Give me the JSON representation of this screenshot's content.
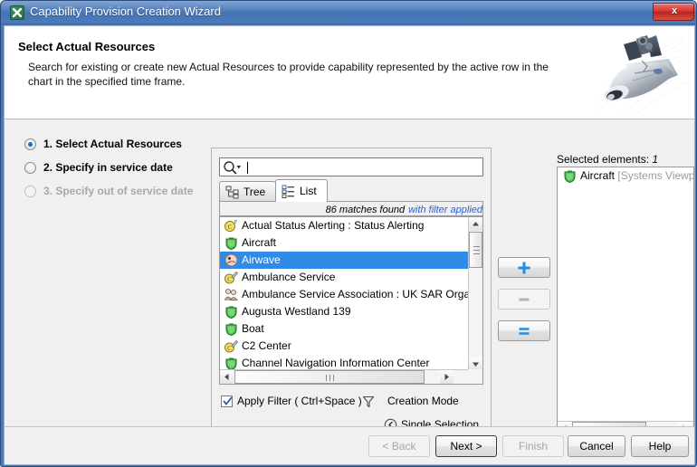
{
  "window": {
    "title": "Capability Provision Creation Wizard",
    "icon": "app-icon",
    "close_label": "x"
  },
  "banner": {
    "title": "Select Actual Resources",
    "description": "Search for existing or create new Actual Resources to provide capability represented by the active row in the chart in the specified time frame.",
    "graphic": "space-shuttle-image"
  },
  "steps": [
    {
      "label": "1. Select Actual Resources",
      "state": "selected"
    },
    {
      "label": "2. Specify in service date",
      "state": "enabled"
    },
    {
      "label": "3. Specify out of service date",
      "state": "disabled"
    }
  ],
  "search": {
    "value": "",
    "placeholder": "",
    "icon": "search-icon"
  },
  "tabs": [
    {
      "label": "Tree",
      "icon": "tree-icon",
      "active": false
    },
    {
      "label": "List",
      "icon": "list-icon",
      "active": true
    }
  ],
  "matches": {
    "count_text": "86 matches found",
    "filter_text": "with filter applied"
  },
  "list": {
    "items": [
      {
        "label": "Actual Status Alerting : Status Alerting",
        "icon": "actual-status-icon",
        "selected": false
      },
      {
        "label": "Aircraft",
        "icon": "resource-shield-icon",
        "selected": false
      },
      {
        "label": "Airwave",
        "icon": "airwave-circle-icon",
        "selected": true
      },
      {
        "label": "Ambulance Service",
        "icon": "service-wrench-icon",
        "selected": false
      },
      {
        "label": "Ambulance Service Association : UK SAR Organizatio",
        "icon": "organization-icon",
        "selected": false
      },
      {
        "label": "Augusta Westland 139",
        "icon": "resource-shield-icon",
        "selected": false
      },
      {
        "label": "Boat",
        "icon": "resource-shield-icon",
        "selected": false
      },
      {
        "label": "C2 Center",
        "icon": "service-wrench-icon",
        "selected": false
      },
      {
        "label": "Channel Navigation Information Center",
        "icon": "resource-shield-icon",
        "selected": false
      }
    ]
  },
  "filter": {
    "checkbox_label": "Apply Filter ( Ctrl+Space )",
    "checked": true,
    "funnel_icon": "funnel-icon"
  },
  "creation_mode": {
    "label": "Creation Mode",
    "selection_label": "Single Selection",
    "selection_icon": "chevron-left-circle-icon"
  },
  "transfer": {
    "add_label": "+",
    "remove_label": "−",
    "set_label": "=",
    "add_enabled": true,
    "remove_enabled": false,
    "set_enabled": true
  },
  "selected_panel": {
    "title": "Selected elements:",
    "count": "1",
    "items": [
      {
        "label": "Aircraft",
        "meta": "[Systems Viewpo",
        "icon": "resource-shield-icon"
      }
    ]
  },
  "buttons": {
    "back": "< Back",
    "next": "Next >",
    "finish": "Finish",
    "cancel": "Cancel",
    "help": "Help"
  },
  "colors": {
    "titlebar": "#4a79b8",
    "selection": "#2f8ae8",
    "link": "#2b5fd9",
    "accent_blue": "#1f8fe8"
  }
}
